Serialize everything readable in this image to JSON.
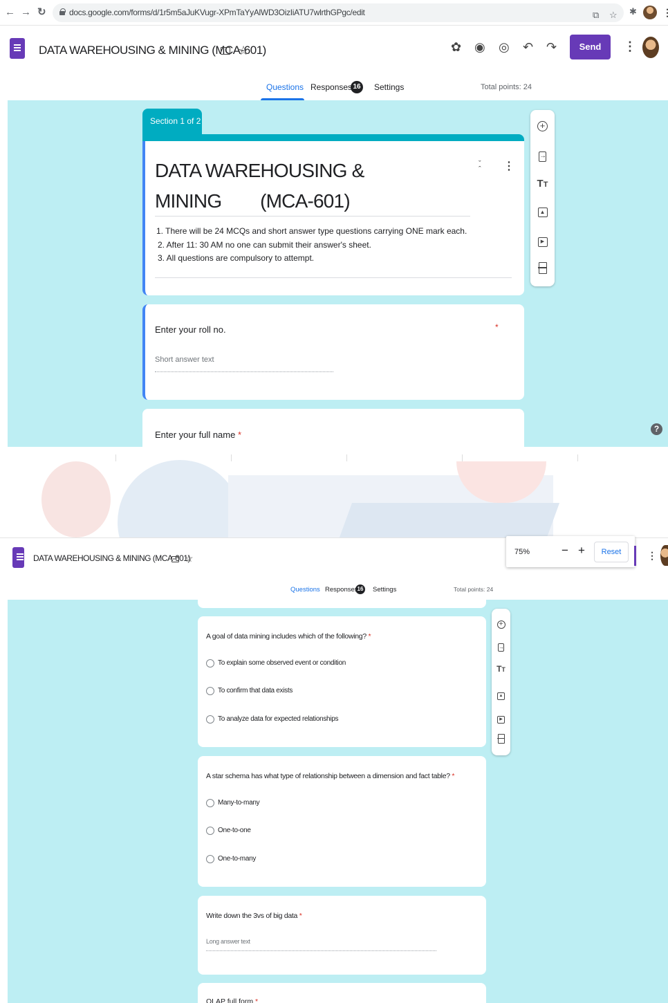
{
  "browser": {
    "url": "docs.google.com/forms/d/1r5m5aJuKVugr-XPmTaYyAlWD3OizIiATU7wlrthGPgc/edit",
    "icons": [
      "back-icon",
      "forward-icon",
      "reload-icon",
      "lock-icon",
      "share-icon",
      "bookmark-star-icon",
      "extensions-icon",
      "profile-avatar",
      "browser-menu-icon"
    ]
  },
  "header": {
    "doc_title": "DATA WAREHOUSING & MINING (MCA-601)",
    "send_label": "Send",
    "icons": [
      "addons-icon",
      "palette-icon",
      "preview-icon",
      "undo-icon",
      "redo-icon",
      "more-icon"
    ]
  },
  "tabs": {
    "questions": "Questions",
    "responses": "Responses",
    "responses_count": "16",
    "settings": "Settings",
    "total_points": "Total points: 24"
  },
  "section": {
    "label": "Section 1 of 2",
    "title": "DATA WAREHOUSING & MINING        (MCA-601)",
    "description": [
      "1. There will be 24 MCQs and short answer type questions carrying ONE mark each.",
      "2. After 11: 30 AM no one can submit their answer's sheet.",
      "3. All questions are compulsory to attempt."
    ]
  },
  "questions_top": [
    {
      "title": "Enter your roll no.",
      "required": "*",
      "placeholder": "Short answer text"
    },
    {
      "title": "Enter your full name",
      "required": "*"
    }
  ],
  "toolbar_icons": [
    "add-question-icon",
    "import-questions-icon",
    "add-title-icon",
    "add-image-icon",
    "add-video-icon",
    "add-section-icon"
  ],
  "zoom": {
    "level": "75%",
    "minus": "−",
    "plus": "+",
    "reset": "Reset"
  },
  "questions_bottom": [
    {
      "title": "A goal of data mining includes which of the following?",
      "required": "*",
      "options": [
        "To explain some observed event or condition",
        "To confirm that data exists",
        "To analyze data for expected relationships"
      ]
    },
    {
      "title": "A star schema has what type of relationship between a dimension and fact table?",
      "required": "*",
      "options": [
        "Many-to-many",
        "One-to-one",
        "One-to-many"
      ]
    },
    {
      "title": "Write down the 3vs of big data",
      "required": "*",
      "placeholder": "Long answer text"
    },
    {
      "title": "OLAP full form",
      "required": "*"
    }
  ]
}
